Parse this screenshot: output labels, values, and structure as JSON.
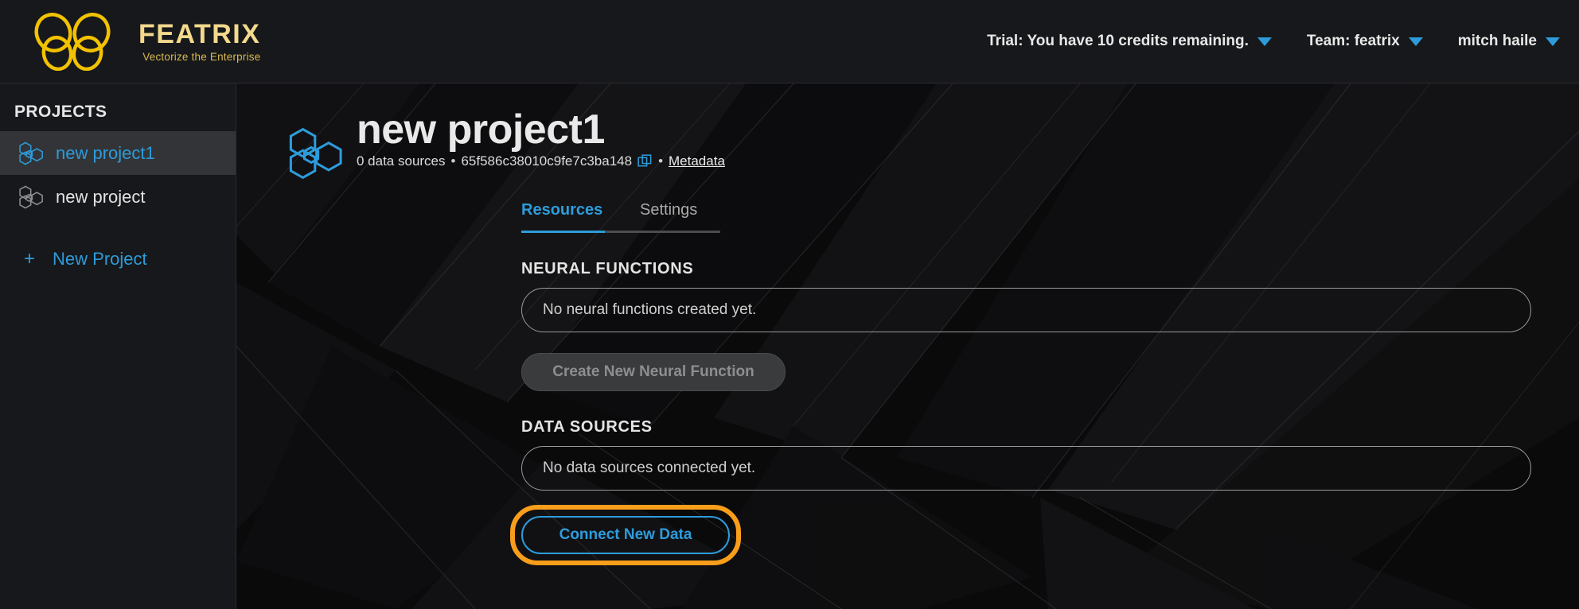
{
  "brand": {
    "name": "FEATRIX",
    "tagline": "Vectorize the Enterprise",
    "logo_icon": "butterfly-logo-icon",
    "logo_color": "#f2c200",
    "name_color": "#f2d98c"
  },
  "topbar": {
    "trial_label": "Trial: You have 10 credits remaining.",
    "team_label": "Team: featrix",
    "user_label": "mitch haile",
    "caret_icon": "chevron-down-icon",
    "accent_color": "#2d9cdb"
  },
  "sidebar": {
    "title": "PROJECTS",
    "items": [
      {
        "label": "new project1",
        "icon": "hexagon-cluster-icon",
        "active": true
      },
      {
        "label": "new project",
        "icon": "hexagon-cluster-icon",
        "active": false
      }
    ],
    "new_project_label": "New Project",
    "new_project_plus": "+"
  },
  "project": {
    "icon": "hexagon-cluster-icon",
    "name": "new project1",
    "data_sources_count": "0 data sources",
    "separator": "•",
    "id": "65f586c38010c9fe7c3ba148",
    "copy_icon": "copy-icon",
    "metadata_link": "Metadata"
  },
  "tabs": [
    {
      "label": "Resources",
      "active": true
    },
    {
      "label": "Settings",
      "active": false
    }
  ],
  "neural_functions": {
    "section_label": "NEURAL FUNCTIONS",
    "empty_message": "No neural functions created yet.",
    "button_label": "Create New Neural Function",
    "button_disabled": true
  },
  "data_sources": {
    "section_label": "DATA SOURCES",
    "empty_message": "No data sources connected yet.",
    "button_label": "Connect New Data",
    "highlighted": true,
    "highlight_color": "#f89e1b"
  }
}
